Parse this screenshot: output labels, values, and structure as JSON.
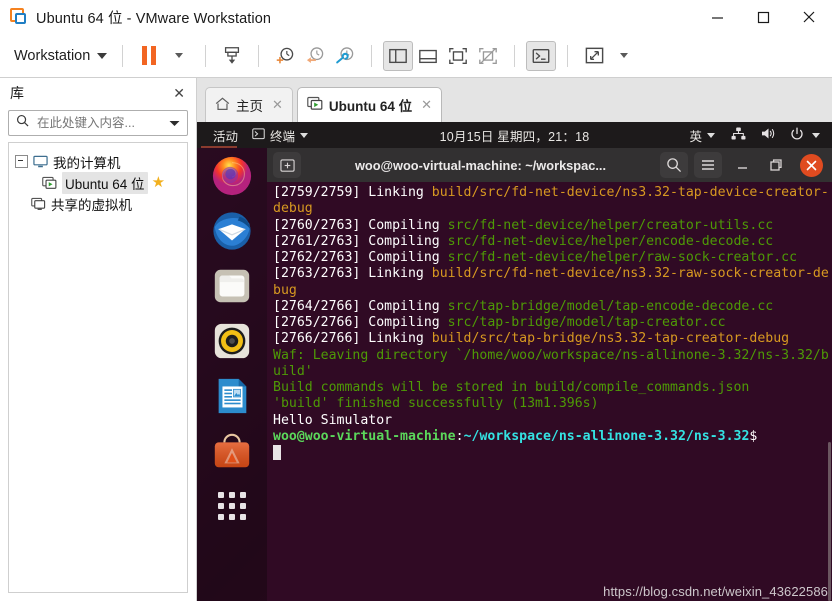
{
  "window": {
    "title": "Ubuntu 64 位 - VMware Workstation",
    "logo_icon": "vmware-logo-icon",
    "controls": [
      {
        "name": "minimize-button",
        "icon": "minimize-icon"
      },
      {
        "name": "maximize-button",
        "icon": "maximize-icon"
      },
      {
        "name": "close-button",
        "icon": "close-icon"
      }
    ]
  },
  "toolbar": {
    "menu_label": "Workstation",
    "buttons": [
      {
        "name": "pause-vm-button",
        "icon": "pause-icon"
      },
      {
        "name": "pause-dropdown-button",
        "icon": "chevron-down-icon"
      },
      {
        "name": "send-ctrl-alt-del-button",
        "icon": "send-key-icon"
      },
      {
        "name": "take-snapshot-button",
        "icon": "snapshot-add-icon"
      },
      {
        "name": "revert-snapshot-button",
        "icon": "snapshot-revert-icon"
      },
      {
        "name": "manage-snapshots-button",
        "icon": "snapshot-manage-icon"
      },
      {
        "name": "show-library-button",
        "icon": "panel-left-icon"
      },
      {
        "name": "show-thumbnail-bar-button",
        "icon": "panel-bottom-icon"
      },
      {
        "name": "show-console-view-button",
        "icon": "console-view-icon"
      },
      {
        "name": "hide-console-view-button",
        "icon": "console-hidden-icon"
      },
      {
        "name": "show-terminal-button",
        "icon": "terminal-icon"
      },
      {
        "name": "enter-fullscreen-button",
        "icon": "fullscreen-icon"
      },
      {
        "name": "fullscreen-dropdown-button",
        "icon": "chevron-down-icon"
      }
    ]
  },
  "library": {
    "title": "库",
    "close_icon": "close-icon",
    "search": {
      "placeholder": "在此处键入内容...",
      "value": "",
      "icon": "search-icon",
      "dropdown_icon": "chevron-down-icon"
    },
    "tree": [
      {
        "label": "我的计算机",
        "icon": "my-computer-icon",
        "level": 0,
        "expanded": true
      },
      {
        "label": "Ubuntu 64 位",
        "icon": "virtual-machine-running-icon",
        "level": 1,
        "selected": true,
        "favorite_icon": "star-icon"
      },
      {
        "label": "共享的虚拟机",
        "icon": "shared-vms-icon",
        "level": 0
      }
    ]
  },
  "tabs": [
    {
      "label": "主页",
      "icon": "home-icon",
      "active": false,
      "close_icon": "close-icon"
    },
    {
      "label": "Ubuntu 64 位",
      "icon": "virtual-machine-running-icon",
      "active": true,
      "close_icon": "close-icon"
    }
  ],
  "guest": {
    "topbar": {
      "activities": "活动",
      "app_menu": "终端",
      "app_menu_icon": "terminal-icon",
      "app_menu_caret": "chevron-down-icon",
      "clock": "10月15日 星期四，21：18",
      "input_method": "英",
      "input_method_caret": "chevron-down-icon",
      "status_icons": [
        "network-wired-icon",
        "volume-icon",
        "power-icon",
        "chevron-down-icon"
      ]
    },
    "dock": [
      {
        "name": "firefox",
        "icon": "firefox-icon"
      },
      {
        "name": "thunderbird",
        "icon": "thunderbird-icon"
      },
      {
        "name": "files",
        "icon": "files-folder-icon"
      },
      {
        "name": "rhythmbox",
        "icon": "rhythmbox-speaker-icon"
      },
      {
        "name": "libreoffice-writer",
        "icon": "libreoffice-writer-icon"
      },
      {
        "name": "ubuntu-software",
        "icon": "ubuntu-software-icon"
      },
      {
        "name": "show-applications",
        "icon": "apps-grid-icon"
      }
    ],
    "terminal": {
      "titlebar": {
        "new_tab_icon": "new-tab-icon",
        "title": "woo@woo-virtual-machine: ~/workspac...",
        "search_icon": "search-icon",
        "menu_icon": "hamburger-menu-icon",
        "minimize_icon": "minimize-icon",
        "maximize_icon": "maximize-icon",
        "close_icon": "close-icon"
      },
      "lines": [
        {
          "segs": [
            {
              "t": "[2759/2759] Linking ",
              "c": "c-w"
            },
            {
              "t": "build/src/fd-net-device/ns3.32-tap-device-creator-debug",
              "c": "c-y"
            }
          ]
        },
        {
          "segs": [
            {
              "t": "[2760/2763] Compiling ",
              "c": "c-w"
            },
            {
              "t": "src/fd-net-device/helper/creator-utils.cc",
              "c": "c-g"
            }
          ]
        },
        {
          "segs": [
            {
              "t": "[2761/2763] Compiling ",
              "c": "c-w"
            },
            {
              "t": "src/fd-net-device/helper/encode-decode.cc",
              "c": "c-g"
            }
          ]
        },
        {
          "segs": [
            {
              "t": "[2762/2763] Compiling ",
              "c": "c-w"
            },
            {
              "t": "src/fd-net-device/helper/raw-sock-creator.cc",
              "c": "c-g"
            }
          ]
        },
        {
          "segs": [
            {
              "t": "[2763/2763] Linking ",
              "c": "c-w"
            },
            {
              "t": "build/src/fd-net-device/ns3.32-raw-sock-creator-debug",
              "c": "c-y"
            }
          ]
        },
        {
          "segs": [
            {
              "t": "[2764/2766] Compiling ",
              "c": "c-w"
            },
            {
              "t": "src/tap-bridge/model/tap-encode-decode.cc",
              "c": "c-g"
            }
          ]
        },
        {
          "segs": [
            {
              "t": "[2765/2766] Compiling ",
              "c": "c-w"
            },
            {
              "t": "src/tap-bridge/model/tap-creator.cc",
              "c": "c-g"
            }
          ]
        },
        {
          "segs": [
            {
              "t": "[2766/2766] Linking ",
              "c": "c-w"
            },
            {
              "t": "build/src/tap-bridge/ns3.32-tap-creator-debug",
              "c": "c-y"
            }
          ]
        },
        {
          "segs": [
            {
              "t": "Waf: Leaving directory `/home/woo/workspace/ns-allinone-3.32/ns-3.32/build'",
              "c": "c-g"
            }
          ]
        },
        {
          "segs": [
            {
              "t": "Build commands will be stored in build/compile_commands.json",
              "c": "c-g"
            }
          ]
        },
        {
          "segs": [
            {
              "t": "'build' finished successfully (13m1.396s)",
              "c": "c-g"
            }
          ]
        },
        {
          "segs": [
            {
              "t": "Hello Simulator",
              "c": "c-w"
            }
          ]
        },
        {
          "segs": [
            {
              "t": "woo@woo-virtual-machine",
              "c": "c-gb"
            },
            {
              "t": ":",
              "c": "c-w"
            },
            {
              "t": "~/workspace/ns-allinone-3.32/ns-3.32",
              "c": "c-c"
            },
            {
              "t": "$ ",
              "c": "c-w"
            }
          ]
        }
      ]
    }
  },
  "watermark": "https://blog.csdn.net/weixin_43622586"
}
